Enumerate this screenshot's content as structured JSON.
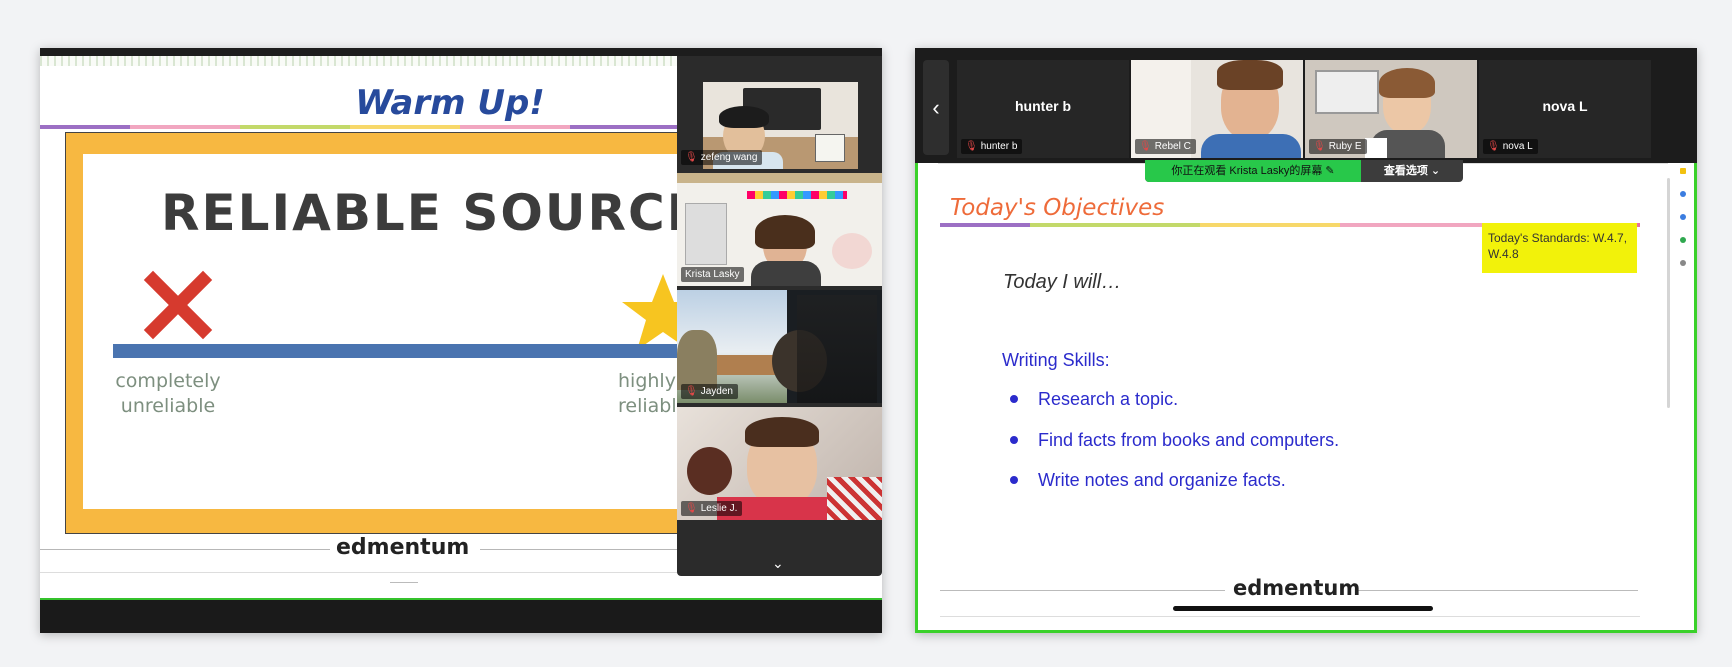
{
  "left": {
    "slide_title": "Warm Up!",
    "heading": "RELIABLE SOURCES",
    "label_left": [
      "completely",
      "unreliable"
    ],
    "label_right": [
      "highly",
      "reliable"
    ],
    "logo": "edmentum",
    "gallery": {
      "participants": [
        {
          "name": "zefeng wang",
          "muted": true
        },
        {
          "name": "Krista Lasky",
          "muted": false
        },
        {
          "name": "Jayden",
          "muted": true
        },
        {
          "name": "Leslie J.",
          "muted": true
        }
      ],
      "scroll_icon": "chevron-down-icon"
    }
  },
  "right": {
    "participants": [
      {
        "name": "hunter b",
        "label": "hunter b",
        "video": false
      },
      {
        "name": "Rebel C",
        "video": true
      },
      {
        "name": "Ruby E",
        "video": true
      },
      {
        "name": "nova L",
        "label": "nova L",
        "video": false
      }
    ],
    "viewing_banner": "你正在观看 Krista Lasky的屏幕",
    "view_options": "查看选项",
    "doc": {
      "title": "Today's Objectives",
      "standards": "Today's Standards: W.4.7, W.4.8",
      "intro": "Today I will…",
      "section": "Writing Skills:",
      "bullets": [
        "Research a topic.",
        "Find facts from books and computers.",
        "Write notes and organize facts."
      ],
      "logo": "edmentum"
    }
  },
  "colors": {
    "accent_green": "#35c22c",
    "muted_red": "#e34848",
    "slide_blue": "#274a9c",
    "objective_orange": "#ee6b3a",
    "bullet_blue": "#2b2bcc",
    "highlight_yellow": "#f2f20a"
  }
}
